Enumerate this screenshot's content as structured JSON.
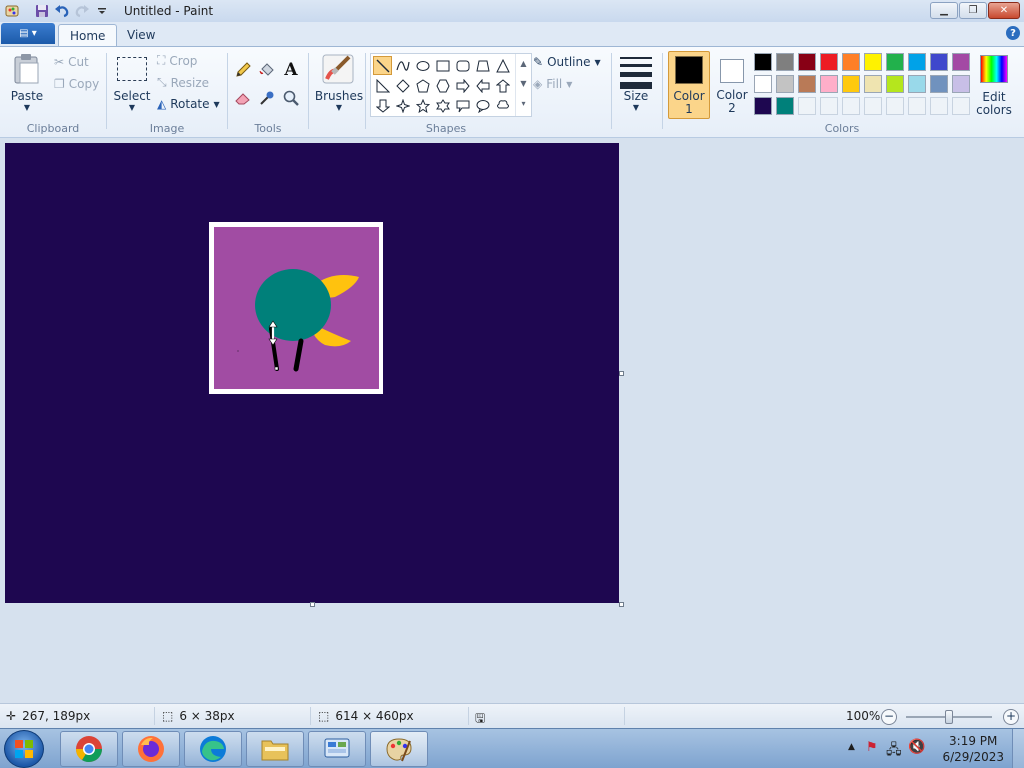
{
  "window": {
    "title": "Untitled - Paint"
  },
  "tabs": [
    {
      "label": "Home",
      "active": true
    },
    {
      "label": "View",
      "active": false
    }
  ],
  "ribbon": {
    "clipboard": {
      "paste": "Paste",
      "cut": "Cut",
      "copy": "Copy",
      "group_label": "Clipboard"
    },
    "image": {
      "select": "Select",
      "crop": "Crop",
      "resize": "Resize",
      "rotate": "Rotate",
      "group_label": "Image"
    },
    "tools": {
      "group_label": "Tools",
      "icons": [
        "pencil-icon",
        "fill-bucket-icon",
        "text-icon",
        "eraser-icon",
        "color-picker-icon",
        "magnifier-icon"
      ]
    },
    "brushes": {
      "label": "Brushes"
    },
    "shapes": {
      "group_label": "Shapes",
      "outline": "Outline",
      "fill": "Fill",
      "selected": "line"
    },
    "size": {
      "label": "Size"
    },
    "colors": {
      "color1_label": "Color",
      "color1_num": "1",
      "color2_label": "Color",
      "color2_num": "2",
      "color1_value": "#000000",
      "color2_value": "#ffffff",
      "edit_label": "Edit",
      "edit_label2": "colors",
      "group_label": "Colors",
      "palette_row1": [
        "#000000",
        "#7f7f7f",
        "#880015",
        "#ed1c24",
        "#ff7f27",
        "#fff200",
        "#22b14c",
        "#00a2e8",
        "#3f48cc",
        "#a349a4"
      ],
      "palette_row2": [
        "#ffffff",
        "#c3c3c3",
        "#b97a57",
        "#ffaec9",
        "#ffc90e",
        "#efe4b0",
        "#b5e61d",
        "#99d9ea",
        "#7092be",
        "#c8bfe7"
      ],
      "palette_row3": [
        "#1e0750",
        "#00807a"
      ]
    }
  },
  "canvas": {
    "background": "#1e0750",
    "picture": {
      "frame_color": "#ffffff",
      "fill_color": "#a14ca3",
      "blob_color": "#00807a",
      "wing_color": "#ffc20e",
      "leg_color": "#000000"
    }
  },
  "status": {
    "cursor_pos": "267, 189px",
    "selection_size": "6 × 38px",
    "canvas_size": "614 × 460px",
    "zoom": "100%",
    "zoom_level": 0.5
  },
  "taskbar": {
    "apps": [
      "chrome-icon",
      "firefox-icon",
      "edge-icon",
      "file-explorer-icon",
      "control-panel-icon",
      "paint-icon"
    ],
    "time": "3:19 PM",
    "date": "6/29/2023"
  }
}
